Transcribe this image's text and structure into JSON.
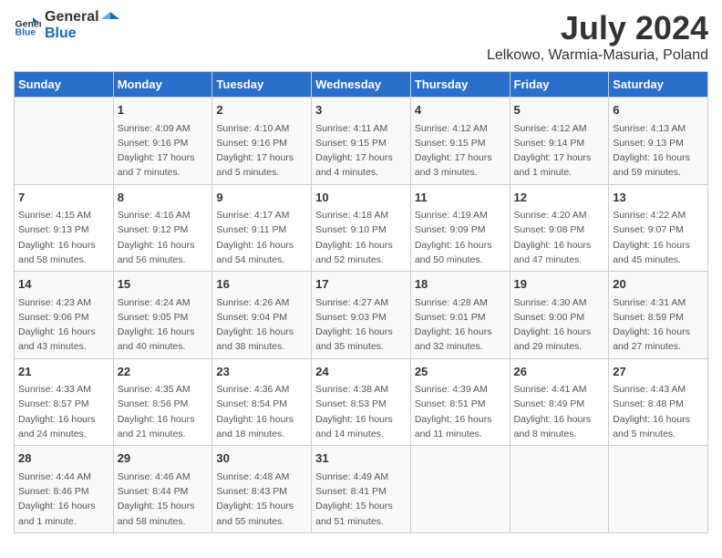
{
  "header": {
    "logo_general": "General",
    "logo_blue": "Blue",
    "title": "July 2024",
    "subtitle": "Lelkowo, Warmia-Masuria, Poland"
  },
  "columns": [
    "Sunday",
    "Monday",
    "Tuesday",
    "Wednesday",
    "Thursday",
    "Friday",
    "Saturday"
  ],
  "weeks": [
    [
      {
        "day": "",
        "info": ""
      },
      {
        "day": "1",
        "info": "Sunrise: 4:09 AM\nSunset: 9:16 PM\nDaylight: 17 hours\nand 7 minutes."
      },
      {
        "day": "2",
        "info": "Sunrise: 4:10 AM\nSunset: 9:16 PM\nDaylight: 17 hours\nand 5 minutes."
      },
      {
        "day": "3",
        "info": "Sunrise: 4:11 AM\nSunset: 9:15 PM\nDaylight: 17 hours\nand 4 minutes."
      },
      {
        "day": "4",
        "info": "Sunrise: 4:12 AM\nSunset: 9:15 PM\nDaylight: 17 hours\nand 3 minutes."
      },
      {
        "day": "5",
        "info": "Sunrise: 4:12 AM\nSunset: 9:14 PM\nDaylight: 17 hours\nand 1 minute."
      },
      {
        "day": "6",
        "info": "Sunrise: 4:13 AM\nSunset: 9:13 PM\nDaylight: 16 hours\nand 59 minutes."
      }
    ],
    [
      {
        "day": "7",
        "info": "Sunrise: 4:15 AM\nSunset: 9:13 PM\nDaylight: 16 hours\nand 58 minutes."
      },
      {
        "day": "8",
        "info": "Sunrise: 4:16 AM\nSunset: 9:12 PM\nDaylight: 16 hours\nand 56 minutes."
      },
      {
        "day": "9",
        "info": "Sunrise: 4:17 AM\nSunset: 9:11 PM\nDaylight: 16 hours\nand 54 minutes."
      },
      {
        "day": "10",
        "info": "Sunrise: 4:18 AM\nSunset: 9:10 PM\nDaylight: 16 hours\nand 52 minutes."
      },
      {
        "day": "11",
        "info": "Sunrise: 4:19 AM\nSunset: 9:09 PM\nDaylight: 16 hours\nand 50 minutes."
      },
      {
        "day": "12",
        "info": "Sunrise: 4:20 AM\nSunset: 9:08 PM\nDaylight: 16 hours\nand 47 minutes."
      },
      {
        "day": "13",
        "info": "Sunrise: 4:22 AM\nSunset: 9:07 PM\nDaylight: 16 hours\nand 45 minutes."
      }
    ],
    [
      {
        "day": "14",
        "info": "Sunrise: 4:23 AM\nSunset: 9:06 PM\nDaylight: 16 hours\nand 43 minutes."
      },
      {
        "day": "15",
        "info": "Sunrise: 4:24 AM\nSunset: 9:05 PM\nDaylight: 16 hours\nand 40 minutes."
      },
      {
        "day": "16",
        "info": "Sunrise: 4:26 AM\nSunset: 9:04 PM\nDaylight: 16 hours\nand 38 minutes."
      },
      {
        "day": "17",
        "info": "Sunrise: 4:27 AM\nSunset: 9:03 PM\nDaylight: 16 hours\nand 35 minutes."
      },
      {
        "day": "18",
        "info": "Sunrise: 4:28 AM\nSunset: 9:01 PM\nDaylight: 16 hours\nand 32 minutes."
      },
      {
        "day": "19",
        "info": "Sunrise: 4:30 AM\nSunset: 9:00 PM\nDaylight: 16 hours\nand 29 minutes."
      },
      {
        "day": "20",
        "info": "Sunrise: 4:31 AM\nSunset: 8:59 PM\nDaylight: 16 hours\nand 27 minutes."
      }
    ],
    [
      {
        "day": "21",
        "info": "Sunrise: 4:33 AM\nSunset: 8:57 PM\nDaylight: 16 hours\nand 24 minutes."
      },
      {
        "day": "22",
        "info": "Sunrise: 4:35 AM\nSunset: 8:56 PM\nDaylight: 16 hours\nand 21 minutes."
      },
      {
        "day": "23",
        "info": "Sunrise: 4:36 AM\nSunset: 8:54 PM\nDaylight: 16 hours\nand 18 minutes."
      },
      {
        "day": "24",
        "info": "Sunrise: 4:38 AM\nSunset: 8:53 PM\nDaylight: 16 hours\nand 14 minutes."
      },
      {
        "day": "25",
        "info": "Sunrise: 4:39 AM\nSunset: 8:51 PM\nDaylight: 16 hours\nand 11 minutes."
      },
      {
        "day": "26",
        "info": "Sunrise: 4:41 AM\nSunset: 8:49 PM\nDaylight: 16 hours\nand 8 minutes."
      },
      {
        "day": "27",
        "info": "Sunrise: 4:43 AM\nSunset: 8:48 PM\nDaylight: 16 hours\nand 5 minutes."
      }
    ],
    [
      {
        "day": "28",
        "info": "Sunrise: 4:44 AM\nSunset: 8:46 PM\nDaylight: 16 hours\nand 1 minute."
      },
      {
        "day": "29",
        "info": "Sunrise: 4:46 AM\nSunset: 8:44 PM\nDaylight: 15 hours\nand 58 minutes."
      },
      {
        "day": "30",
        "info": "Sunrise: 4:48 AM\nSunset: 8:43 PM\nDaylight: 15 hours\nand 55 minutes."
      },
      {
        "day": "31",
        "info": "Sunrise: 4:49 AM\nSunset: 8:41 PM\nDaylight: 15 hours\nand 51 minutes."
      },
      {
        "day": "",
        "info": ""
      },
      {
        "day": "",
        "info": ""
      },
      {
        "day": "",
        "info": ""
      }
    ]
  ]
}
